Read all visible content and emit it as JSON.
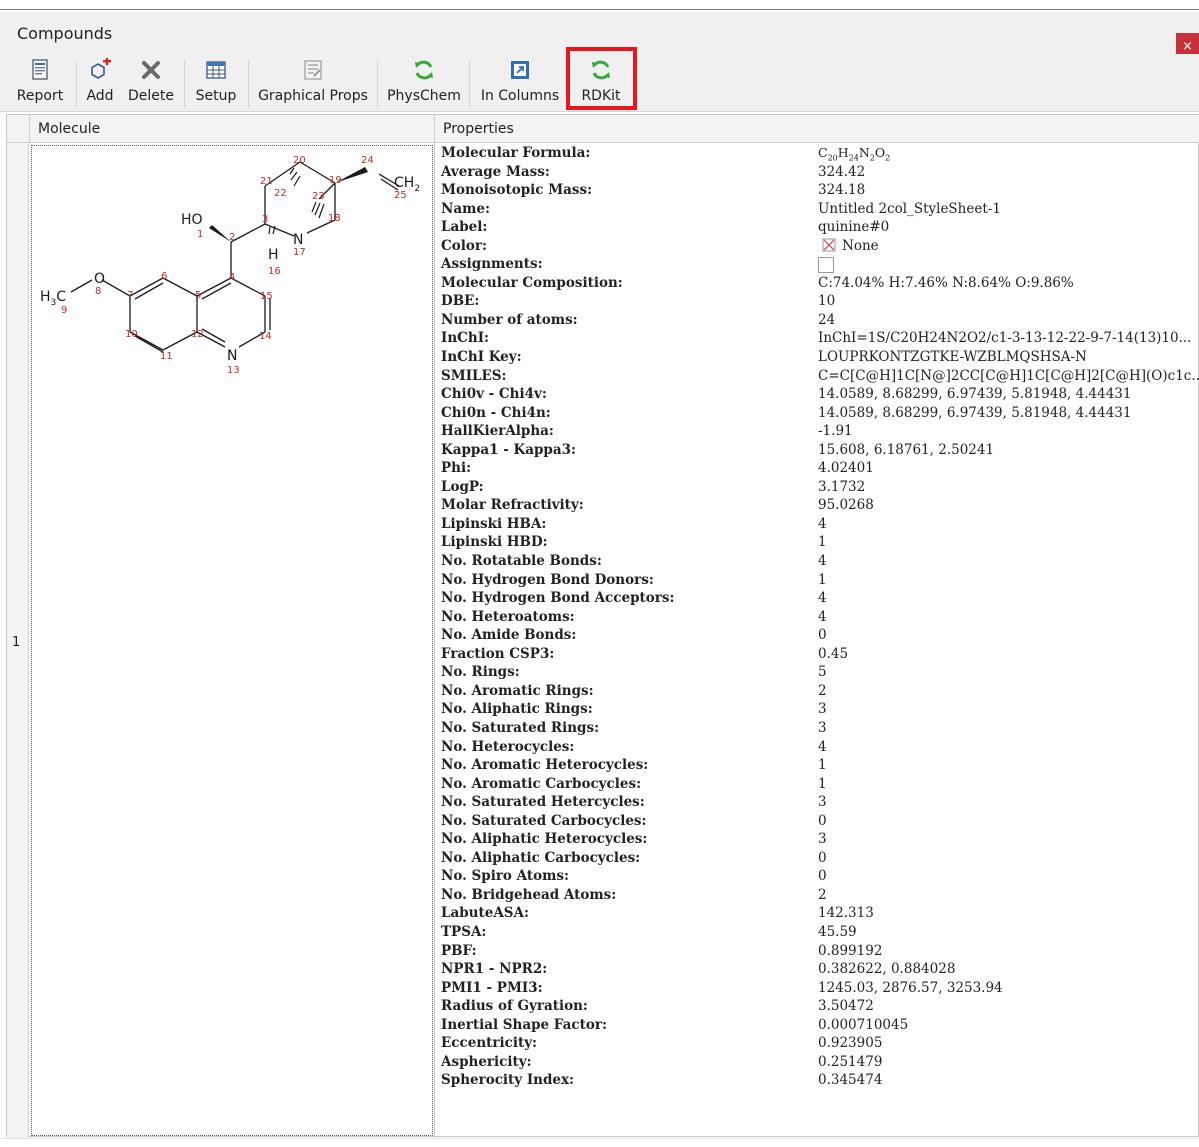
{
  "window": {
    "title": "Compounds",
    "close_glyph": "×"
  },
  "toolbar": {
    "buttons": [
      {
        "label": "Report",
        "icon": "report-icon"
      },
      {
        "label": "Add",
        "icon": "add-molecule-icon"
      },
      {
        "label": "Delete",
        "icon": "delete-icon"
      },
      {
        "label": "Setup",
        "icon": "setup-table-icon"
      },
      {
        "label": "Graphical Props",
        "icon": "graphical-props-icon"
      },
      {
        "label": "PhysChem",
        "icon": "refresh-icon"
      },
      {
        "label": "In Columns",
        "icon": "columns-icon"
      },
      {
        "label": "RDKit",
        "icon": "refresh-icon"
      }
    ],
    "highlighted": "RDKit",
    "highlight_color": "#e8161e"
  },
  "grid": {
    "columns": [
      "Molecule",
      "Properties"
    ],
    "row_number": "1"
  },
  "molecule": {
    "atoms": [
      {
        "t": "HO",
        "n": "1"
      },
      {
        "t": "",
        "n": "2"
      },
      {
        "t": "",
        "n": "3"
      },
      {
        "t": "",
        "n": "4"
      },
      {
        "t": "",
        "n": "5"
      },
      {
        "t": "",
        "n": "6"
      },
      {
        "t": "",
        "n": "7"
      },
      {
        "t": "O",
        "n": "8"
      },
      {
        "t": "H3C",
        "n": "9"
      },
      {
        "t": "",
        "n": "10"
      },
      {
        "t": "",
        "n": "11"
      },
      {
        "t": "",
        "n": "12"
      },
      {
        "t": "N",
        "n": "13"
      },
      {
        "t": "",
        "n": "14"
      },
      {
        "t": "",
        "n": "15"
      },
      {
        "t": "H",
        "n": "16"
      },
      {
        "t": "N",
        "n": "17"
      },
      {
        "t": "",
        "n": "18"
      },
      {
        "t": "",
        "n": "19"
      },
      {
        "t": "",
        "n": "20"
      },
      {
        "t": "",
        "n": "21"
      },
      {
        "t": "",
        "n": "22"
      },
      {
        "t": "",
        "n": "23"
      },
      {
        "t": "",
        "n": "24"
      },
      {
        "t": "CH2",
        "n": "25"
      }
    ]
  },
  "properties": [
    {
      "key": "Molecular Formula:",
      "value": "C20H24N2O2"
    },
    {
      "key": "Average Mass:",
      "value": "324.42"
    },
    {
      "key": "Monoisotopic Mass:",
      "value": "324.18"
    },
    {
      "key": "Name:",
      "value": "Untitled 2col_StyleSheet-1"
    },
    {
      "key": "Label:",
      "value": "quinine#0"
    },
    {
      "key": "Color:",
      "value": "None"
    },
    {
      "key": "Assignments:",
      "value": ""
    },
    {
      "key": "Molecular Composition:",
      "value": "C:74.04% H:7.46% N:8.64% O:9.86%"
    },
    {
      "key": "DBE:",
      "value": "10"
    },
    {
      "key": "Number of atoms:",
      "value": "24"
    },
    {
      "key": "InChI:",
      "value": "InChI=1S/C20H24N2O2/c1-3-13-12-22-9-7-14(13)10..."
    },
    {
      "key": "InChI Key:",
      "value": "LOUPRKONTZGTKE-WZBLMQSHSA-N"
    },
    {
      "key": "SMILES:",
      "value": "C=C[C@H]1C[N@]2CC[C@H]1C[C@H]2[C@H](O)c1c..."
    },
    {
      "key": "Chi0v - Chi4v:",
      "value": "14.0589, 8.68299, 6.97439, 5.81948, 4.44431"
    },
    {
      "key": "Chi0n - Chi4n:",
      "value": "14.0589, 8.68299, 6.97439, 5.81948, 4.44431"
    },
    {
      "key": "HallKierAlpha:",
      "value": "-1.91"
    },
    {
      "key": "Kappa1 - Kappa3:",
      "value": "15.608, 6.18761, 2.50241"
    },
    {
      "key": "Phi:",
      "value": "4.02401"
    },
    {
      "key": "LogP:",
      "value": "3.1732"
    },
    {
      "key": "Molar Refractivity:",
      "value": "95.0268"
    },
    {
      "key": "Lipinski HBA:",
      "value": "4"
    },
    {
      "key": "Lipinski HBD:",
      "value": "1"
    },
    {
      "key": "No. Rotatable Bonds:",
      "value": "4"
    },
    {
      "key": "No. Hydrogen Bond Donors:",
      "value": "1"
    },
    {
      "key": "No. Hydrogen Bond Acceptors:",
      "value": "4"
    },
    {
      "key": "No. Heteroatoms:",
      "value": "4"
    },
    {
      "key": "No. Amide Bonds:",
      "value": "0"
    },
    {
      "key": "Fraction CSP3:",
      "value": "0.45"
    },
    {
      "key": "No. Rings:",
      "value": "5"
    },
    {
      "key": "No. Aromatic Rings:",
      "value": "2"
    },
    {
      "key": "No. Aliphatic Rings:",
      "value": "3"
    },
    {
      "key": "No. Saturated Rings:",
      "value": "3"
    },
    {
      "key": "No. Heterocycles:",
      "value": "4"
    },
    {
      "key": "No. Aromatic Heterocycles:",
      "value": "1"
    },
    {
      "key": "No. Aromatic Carbocycles:",
      "value": "1"
    },
    {
      "key": "No. Saturated Hetercycles:",
      "value": "3"
    },
    {
      "key": "No. Saturated Carbocycles:",
      "value": "0"
    },
    {
      "key": "No. Aliphatic Heterocycles:",
      "value": "3"
    },
    {
      "key": "No. Aliphatic Carbocycles:",
      "value": "0"
    },
    {
      "key": "No. Spiro Atoms:",
      "value": "0"
    },
    {
      "key": "No. Bridgehead Atoms:",
      "value": "2"
    },
    {
      "key": "LabuteASA:",
      "value": "142.313"
    },
    {
      "key": "TPSA:",
      "value": "45.59"
    },
    {
      "key": "PBF:",
      "value": "0.899192"
    },
    {
      "key": "NPR1 - NPR2:",
      "value": "0.382622, 0.884028"
    },
    {
      "key": "PMI1 - PMI3:",
      "value": "1245.03, 2876.57, 3253.94"
    },
    {
      "key": "Radius of Gyration:",
      "value": "3.50472"
    },
    {
      "key": "Inertial Shape Factor:",
      "value": "0.000710045"
    },
    {
      "key": "Eccentricity:",
      "value": "0.923905"
    },
    {
      "key": "Asphericity:",
      "value": "0.251479"
    },
    {
      "key": "Spherocity Index:",
      "value": "0.345474"
    }
  ]
}
